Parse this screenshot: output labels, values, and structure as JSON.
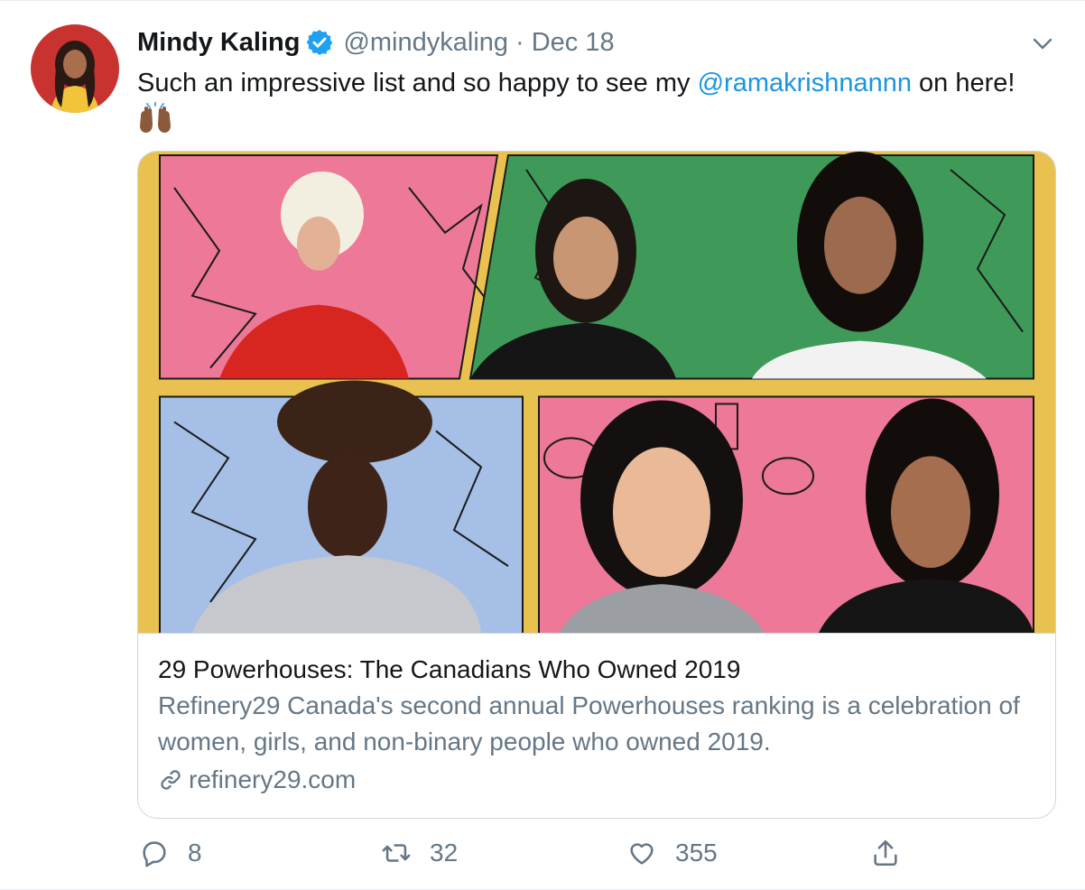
{
  "tweet": {
    "author_name": "Mindy Kaling",
    "handle": "@mindykaling",
    "separator": "·",
    "date": "Dec 18",
    "text_before": "Such an impressive list and so happy to see my ",
    "mention": "@ramakrishnannn",
    "text_after": " on here! ",
    "emoji": "raising-hands-emoji"
  },
  "card": {
    "title": "29 Powerhouses: The Canadians Who Owned 2019",
    "description": "Refinery29 Canada's second annual Powerhouses ranking is a celebration of women, girls, and non-binary people who owned 2019.",
    "domain": "refinery29.com"
  },
  "actions": {
    "replies": "8",
    "retweets": "32",
    "likes": "355"
  },
  "icons": [
    "verified-badge-icon",
    "chevron-down-icon",
    "link-icon",
    "reply-icon",
    "retweet-icon",
    "like-icon",
    "share-icon"
  ],
  "colors": {
    "link_blue": "#1b95e0",
    "verified_blue": "#1da1f2",
    "muted_gray": "#657786",
    "text": "#14171a",
    "border": "#ccd6dd",
    "card_frame_yellow": "#e9c150",
    "panel_pink": "#ee7898",
    "panel_green": "#3f9a5a",
    "panel_blue": "#a5bfe6"
  }
}
